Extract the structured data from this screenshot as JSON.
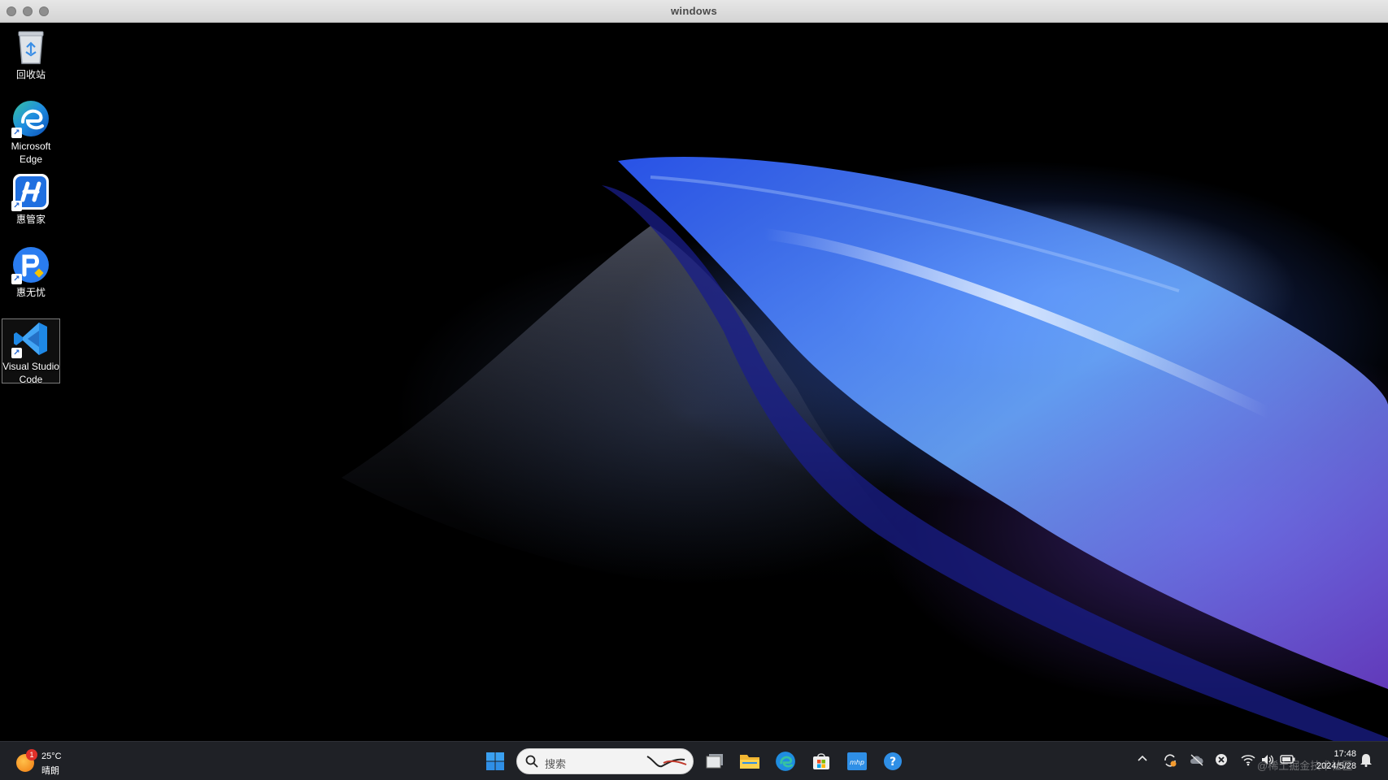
{
  "window": {
    "title": "windows"
  },
  "desktop": {
    "icons": [
      {
        "label": "回收站",
        "icon": "recycle-bin-icon"
      },
      {
        "label": "Microsoft Edge",
        "icon": "edge-icon"
      },
      {
        "label": "惠管家",
        "icon": "huiguanjia-icon"
      },
      {
        "label": "惠无忧",
        "icon": "huiwuyou-icon"
      },
      {
        "label": "Visual Studio Code",
        "icon": "vscode-icon"
      }
    ]
  },
  "taskbar": {
    "weather": {
      "badge": "1",
      "temperature": "25°C",
      "condition": "晴朗"
    },
    "search": {
      "placeholder": "搜索"
    },
    "pinned": [
      "start-icon",
      "task-view-icon",
      "file-explorer-icon",
      "edge-icon",
      "microsoft-store-icon",
      "mhp-app-icon",
      "help-icon"
    ],
    "clock": {
      "time": "17:48",
      "date": "2024/5/28"
    }
  },
  "watermark": "@稀土掘金技术社区",
  "colors": {
    "taskbar": "#1f2126",
    "accent": "#3a8ee6"
  }
}
